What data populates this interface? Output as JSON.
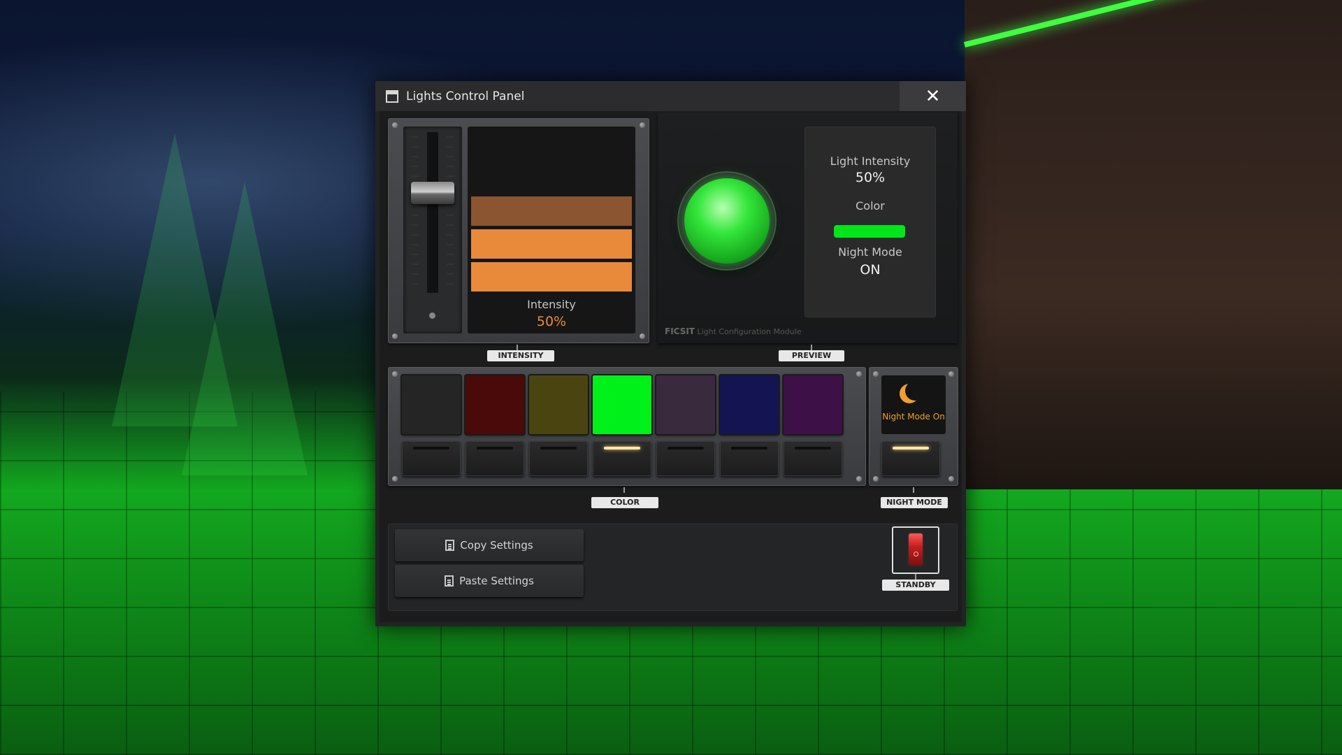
{
  "window": {
    "title": "Lights Control Panel",
    "close_glyph": "✕"
  },
  "intensity": {
    "caption": "Intensity",
    "value_text": "50%",
    "value": 50,
    "value_color": "#f08a3a",
    "bar_colors": [
      "#8a5530",
      "#e98a3a",
      "#e98a3a"
    ],
    "tag": "INTENSITY"
  },
  "preview": {
    "intensity_label": "Light Intensity",
    "intensity_value": "50%",
    "color_label": "Color",
    "color_value": "#00e61a",
    "night_label": "Night Mode",
    "night_value": "ON",
    "footer_brand": "FICSIT",
    "footer_text": "Light Configuration Module",
    "tag": "PREVIEW"
  },
  "colors": {
    "tag": "COLOR",
    "selected_index": 3,
    "swatches": [
      "#252525",
      "#4a0a0a",
      "#4a4510",
      "#00f01a",
      "#3a2a3e",
      "#141452",
      "#3e1048"
    ]
  },
  "night_mode": {
    "label": "Night Mode On",
    "tag": "NIGHT MODE",
    "moon_color": "#f0a030",
    "icon": "moon-icon"
  },
  "actions": {
    "copy_label": "Copy Settings",
    "paste_label": "Paste Settings",
    "standby_tag": "STANDBY"
  }
}
